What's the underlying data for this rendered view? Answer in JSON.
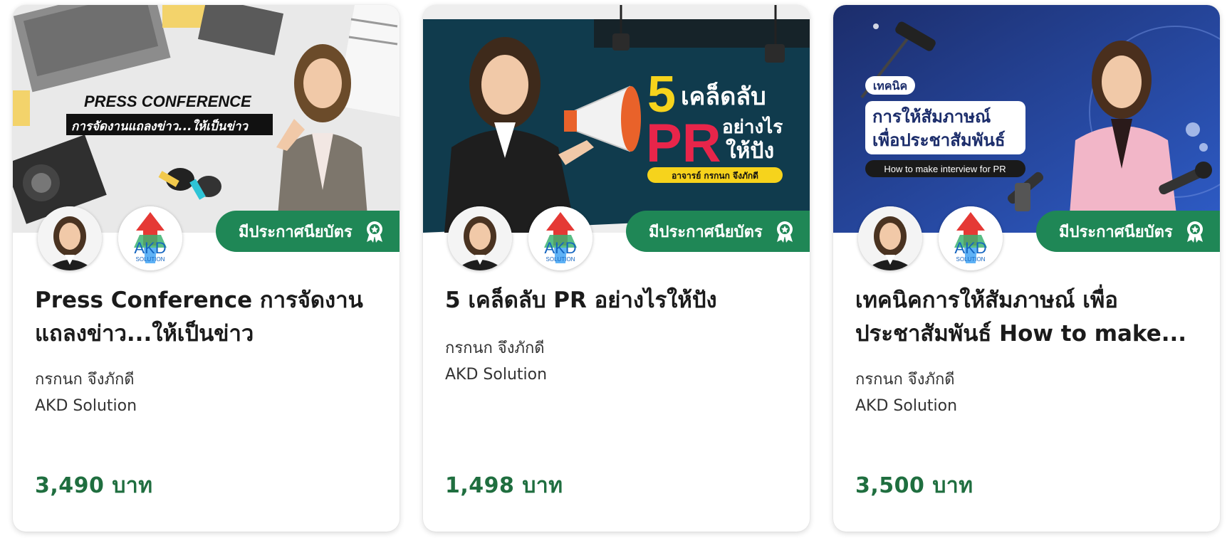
{
  "colors": {
    "accent_green": "#1f8756",
    "price_green": "#1f6e3f",
    "title": "#1b1b1b"
  },
  "certificate_label": "มีประกาศนียบัตร",
  "cards": [
    {
      "title": "Press Conference การจัดงานแถลงข่าว...ให้เป็นข่าว",
      "instructor": "กรกนก จึงภักดี",
      "company": "AKD Solution",
      "price": "3,490 บาท",
      "banner": {
        "line1": "PRESS CONFERENCE",
        "line2": "การจัดงานแถลงข่าว...ให้เป็นข่าว"
      }
    },
    {
      "title": "5 เคล็ดลับ PR อย่างไรให้ปัง",
      "instructor": "กรกนก จึงภักดี",
      "company": "AKD Solution",
      "price": "1,498 บาท",
      "banner": {
        "num": "5",
        "word1": "เคล็ดลับ",
        "pr": "PR",
        "word2": "อย่างไร",
        "word3": "ให้ปัง",
        "teacher": "อาจารย์ กรกนก จึงภักดี"
      }
    },
    {
      "title": "เทคนิคการให้สัมภาษณ์ เพื่อประชาสัมพันธ์ How to make...",
      "instructor": "กรกนก จึงภักดี",
      "company": "AKD Solution",
      "price": "3,500 บาท",
      "banner": {
        "tag": "เทคนิค",
        "line1": "การให้สัมภาษณ์",
        "line2": "เพื่อประชาสัมพันธ์",
        "line3": "How to make interview for PR"
      }
    }
  ],
  "akd_logo": {
    "big": "AKD",
    "small": "SOLUTION"
  }
}
